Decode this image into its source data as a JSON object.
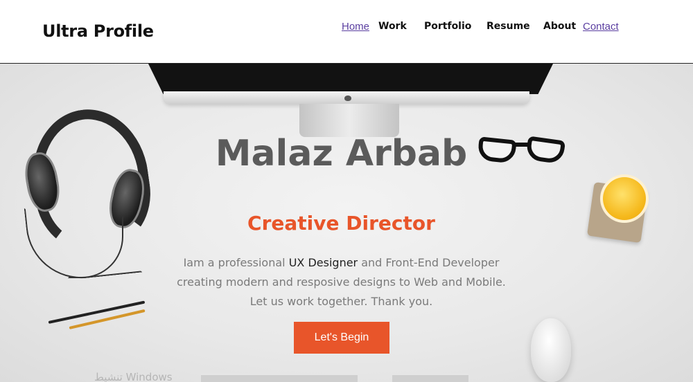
{
  "header": {
    "brand": "Ultra Profile",
    "nav": [
      {
        "label": "Home"
      },
      {
        "label": "Work"
      },
      {
        "label": "Portfolio"
      },
      {
        "label": "Resume"
      },
      {
        "label": "About"
      },
      {
        "label": "Contact"
      }
    ]
  },
  "hero": {
    "name": "Malaz Arbab",
    "role": "Creative Director",
    "desc_part1": "Iam a professional ",
    "desc_highlight": "UX Designer",
    "desc_part2": " and Front-End Developer",
    "desc_line2": "creating modern and resposive designs to Web and Mobile.",
    "desc_line3": "Let us work together. Thank you.",
    "cta_label": "Let's Begin"
  },
  "watermark": "تنشيط Windows",
  "colors": {
    "accent": "#e8552a",
    "name_text": "#5b5b5b",
    "link_visited": "#5a3ea0"
  }
}
